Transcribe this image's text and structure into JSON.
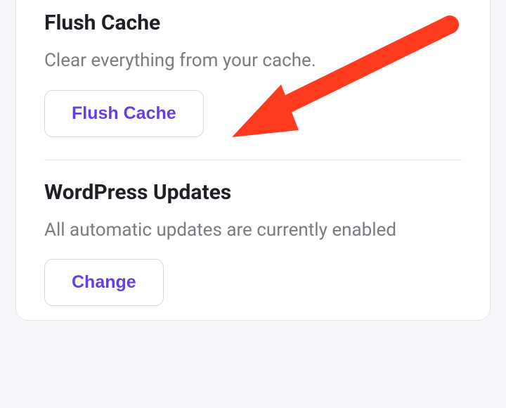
{
  "sections": [
    {
      "title": "Flush Cache",
      "desc": "Clear everything from your cache.",
      "button": "Flush Cache"
    },
    {
      "title": "WordPress Updates",
      "desc": "All automatic updates are currently enabled",
      "button": "Change"
    }
  ],
  "annotation": {
    "arrow_color": "#ff3b1f"
  }
}
